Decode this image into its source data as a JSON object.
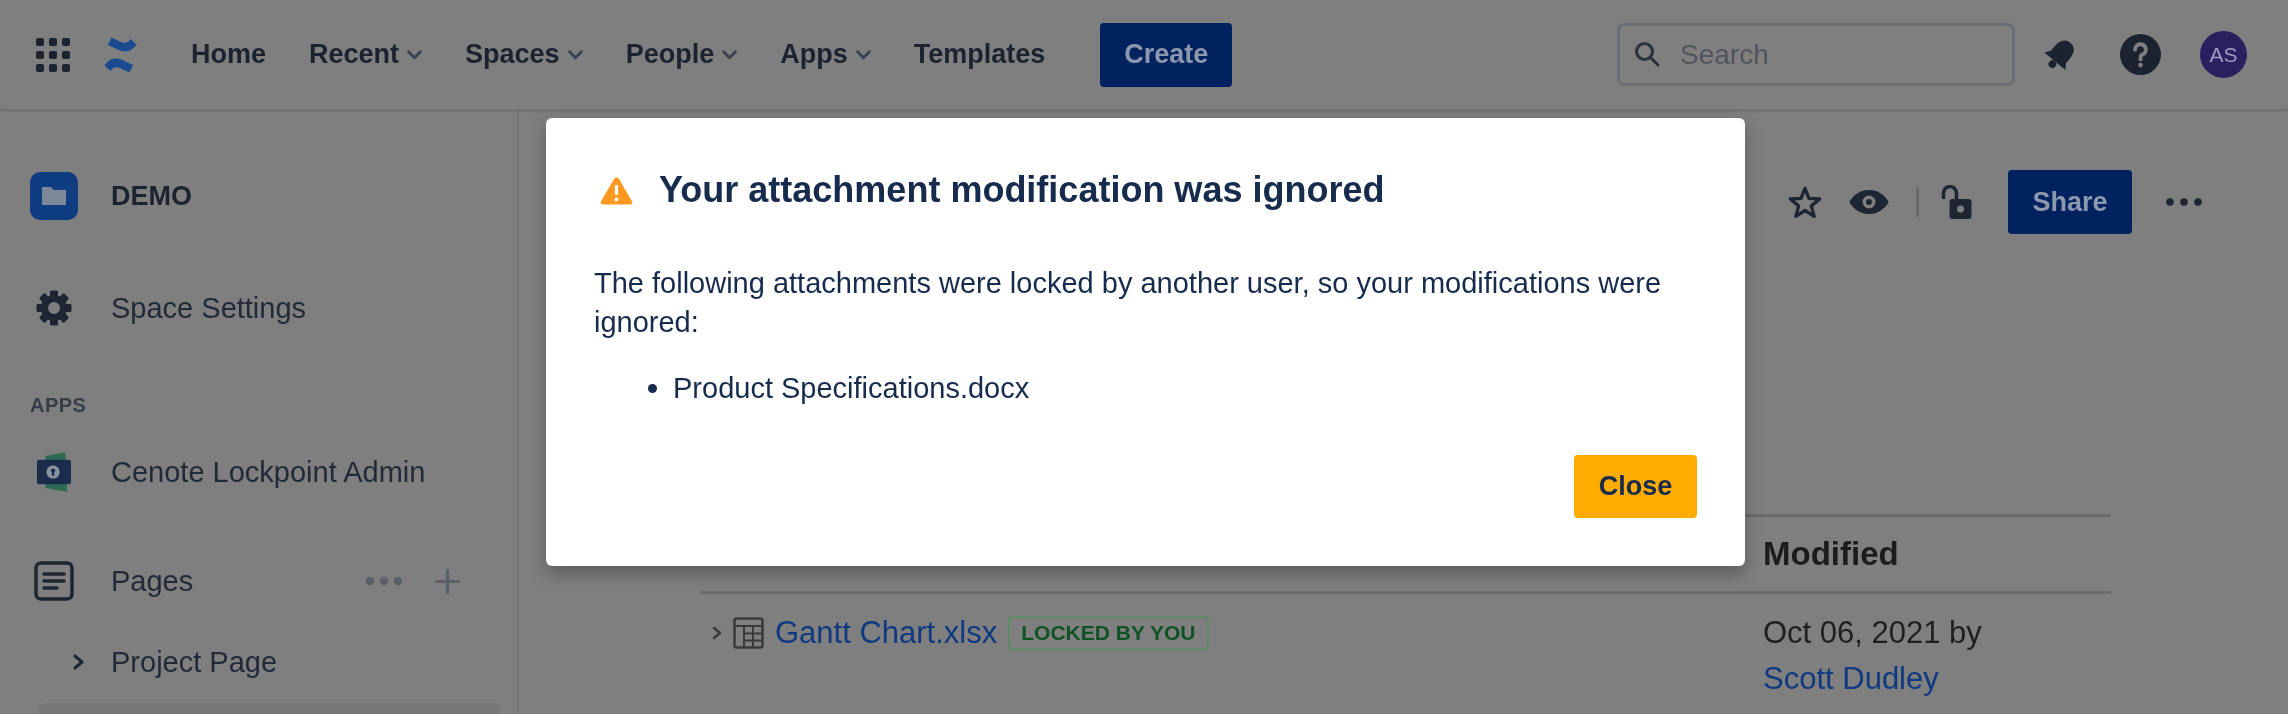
{
  "top_nav": {
    "items": [
      {
        "label": "Home",
        "has_menu": false
      },
      {
        "label": "Recent",
        "has_menu": true
      },
      {
        "label": "Spaces",
        "has_menu": true
      },
      {
        "label": "People",
        "has_menu": true
      },
      {
        "label": "Apps",
        "has_menu": true
      },
      {
        "label": "Templates",
        "has_menu": false
      }
    ],
    "create_button": "Create",
    "search": {
      "placeholder": "Search"
    },
    "avatar": {
      "initials": "AS"
    }
  },
  "sidebar": {
    "space": {
      "name": "DEMO"
    },
    "settings": {
      "label": "Space Settings"
    },
    "apps": {
      "heading": "APPS",
      "items": [
        {
          "label": "Cenote Lockpoint Admin"
        }
      ]
    },
    "pages": {
      "label": "Pages",
      "children": [
        {
          "label": "Project Page",
          "expanded": false
        }
      ]
    }
  },
  "page_toolbar": {
    "share_button": "Share"
  },
  "attachments_table": {
    "columns": [
      {
        "label": "Modified"
      }
    ],
    "rows": [
      {
        "name": "Gantt Chart.xlsx",
        "expanded": false,
        "badge": "LOCKED BY YOU",
        "modified": "Oct 06, 2021 by",
        "modified_by": "Scott Dudley"
      }
    ]
  },
  "dialog": {
    "title": "Your attachment modification was ignored",
    "message": "The following attachments were locked by another user, so your modifications were ignored:",
    "items": [
      "Product Specifications.docx"
    ],
    "buttons": [
      "Close"
    ]
  }
}
